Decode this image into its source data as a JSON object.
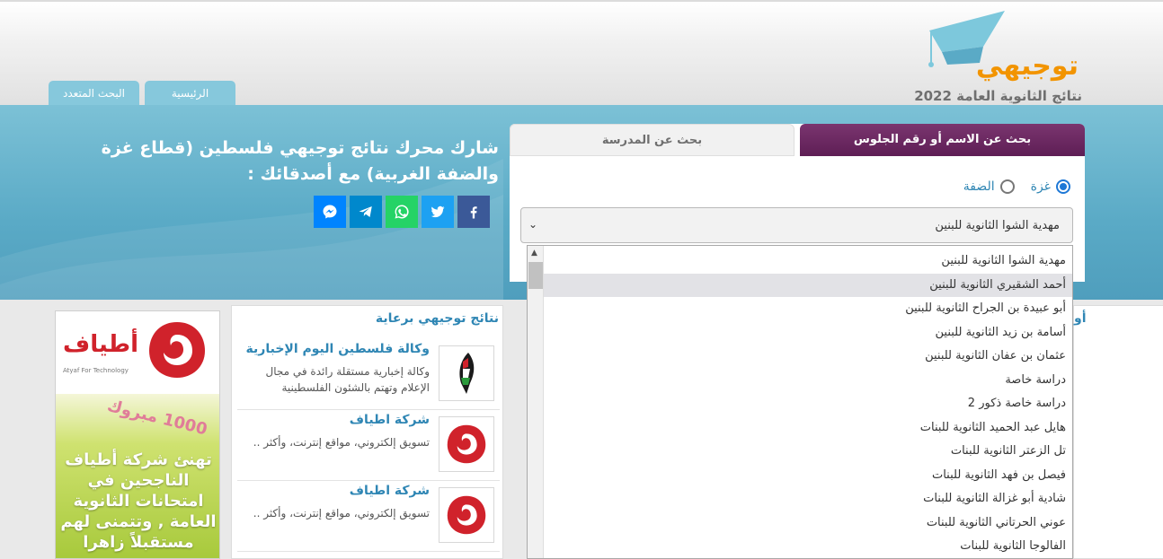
{
  "header": {
    "logo_word": "توجيهي",
    "logo_sub": "نتائج الثانوية العامة 2022",
    "nav_tabs": [
      "الرئيسية",
      "البحث المتعدد"
    ]
  },
  "banner": {
    "share_text": "شارك محرك نتائج توجيهي فلسطين (قطاع غزة والضفة الغربية) مع أصدقائك :",
    "social_icons": [
      {
        "name": "facebook-icon",
        "color": "#3b5998"
      },
      {
        "name": "twitter-icon",
        "color": "#1da1f2"
      },
      {
        "name": "whatsapp-icon",
        "color": "#25d366"
      },
      {
        "name": "telegram-icon",
        "color": "#0088cc"
      },
      {
        "name": "messenger-icon",
        "color": "#0084ff"
      }
    ]
  },
  "search": {
    "tab_name_seat": "بحث عن الاسم أو رقم الجلوس",
    "tab_school": "بحث عن المدرسة",
    "radio_gaza": "غزة",
    "radio_westbank": "الضفة",
    "selected_region": "غزة",
    "selected_school": "مهدية الشوا الثانوية للبنين"
  },
  "dropdown": {
    "items": [
      "مهدية الشوا الثانوية للبنين",
      "أحمد الشقيري الثانوية للبنين",
      "أبو عبيدة بن الجراح الثانوية للبنين",
      "أسامة بن زيد الثانوية للبنين",
      "عثمان بن عفان الثانوية للبنين",
      "دراسة خاصة",
      "دراسة خاصة ذكور 2",
      "هايل عبد الحميد الثانوية للبنات",
      "تل الزعتر الثانوية للبنات",
      "فيصل بن فهد الثانوية للبنات",
      "شادية أبو غزالة الثانوية للبنات",
      "عوني الحرتاني الثانوية للبنات",
      "الفالوجا الثانوية للبنات"
    ],
    "highlighted_index": 1
  },
  "sponsors": {
    "title": "نتائج توجيهي برعاية",
    "items": [
      {
        "name": "وكالة فلسطين اليوم الإخبارية",
        "desc": "وكالة إخبارية مستقلة رائدة في مجال الإعلام وتهتم بالشئون الفلسطينية",
        "icon": "palestine-today-logo-icon"
      },
      {
        "name": "شركة اطياف",
        "desc": "تسويق إلكتروني، مواقع إنترنت، وأكثر ..",
        "icon": "atyaf-logo-icon"
      },
      {
        "name": "شركة اطياف",
        "desc": "تسويق إلكتروني، مواقع إنترنت، وأكثر ..",
        "icon": "atyaf-logo-icon"
      }
    ]
  },
  "ad": {
    "brand": "أطياف",
    "tagline": "Atyaf For Technology",
    "badge": "1000 مبروك",
    "message": "تهنئ شركة أطياف الناجحين في امتحانات الثانوية العامة , وتتمنى لهم مستقبلاً زاهرا"
  },
  "right_panel": {
    "cut_text": "أو"
  },
  "colors": {
    "accent_blue": "#2f86b4",
    "banner_blue": "#5aaac6",
    "active_tab_purple": "#5e1e55",
    "logo_orange": "#f29400"
  }
}
